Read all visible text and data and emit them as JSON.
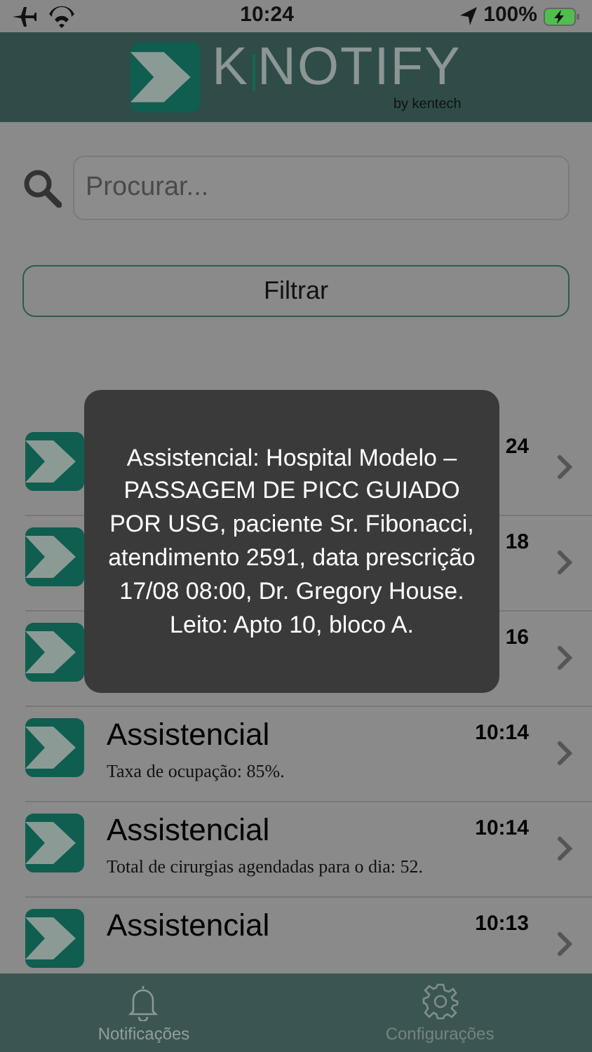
{
  "status_bar": {
    "time": "10:24",
    "battery": "100%"
  },
  "header": {
    "logo_left": "K",
    "logo_right": "NOTIFY",
    "byline": "by kentech"
  },
  "search": {
    "placeholder": "Procurar..."
  },
  "filter_button": "Filtrar",
  "notifications": [
    {
      "time": "24"
    },
    {
      "time": "18"
    },
    {
      "time": "16"
    },
    {
      "title": "Assistencial",
      "time": "10:14",
      "text": "Taxa de ocupação: 85%."
    },
    {
      "title": "Assistencial",
      "time": "10:14",
      "text": "Total de cirurgias agendadas para o dia: 52."
    },
    {
      "title": "Assistencial",
      "time": "10:13"
    }
  ],
  "toast": "Assistencial: Hospital Modelo – PASSAGEM DE PICC GUIADO POR USG, paciente Sr. Fibonacci, atendimento 2591, data prescrição 17/08 08:00, Dr. Gregory House. Leito: Apto 10, bloco A.",
  "tabs": [
    {
      "label": "Notificações",
      "selected": true
    },
    {
      "label": "Configurações",
      "selected": false
    }
  ]
}
